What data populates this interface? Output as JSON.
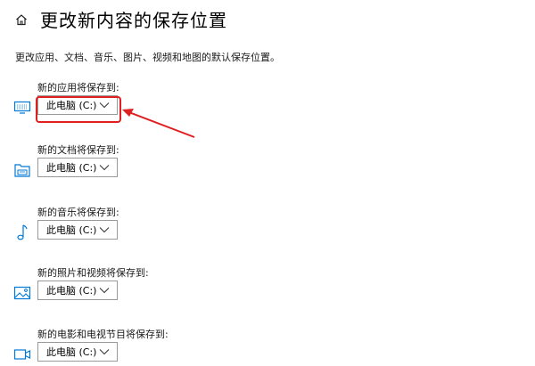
{
  "header": {
    "title": "更改新内容的保存位置",
    "home_icon": "home-icon"
  },
  "description": "更改应用、文档、音乐、图片、视频和地图的默认保存位置。",
  "settings": [
    {
      "label": "新的应用将保存到:",
      "value": "此电脑 (C:)",
      "icon": "monitor-icon"
    },
    {
      "label": "新的文档将保存到:",
      "value": "此电脑 (C:)",
      "icon": "folder-icon"
    },
    {
      "label": "新的音乐将保存到:",
      "value": "此电脑 (C:)",
      "icon": "music-note-icon"
    },
    {
      "label": "新的照片和视频将保存到:",
      "value": "此电脑 (C:)",
      "icon": "picture-icon"
    },
    {
      "label": "新的电影和电视节目将保存到:",
      "value": "此电脑 (C:)",
      "icon": "video-icon"
    }
  ],
  "colors": {
    "accent": "#0078d7",
    "annotation": "#e02020"
  }
}
